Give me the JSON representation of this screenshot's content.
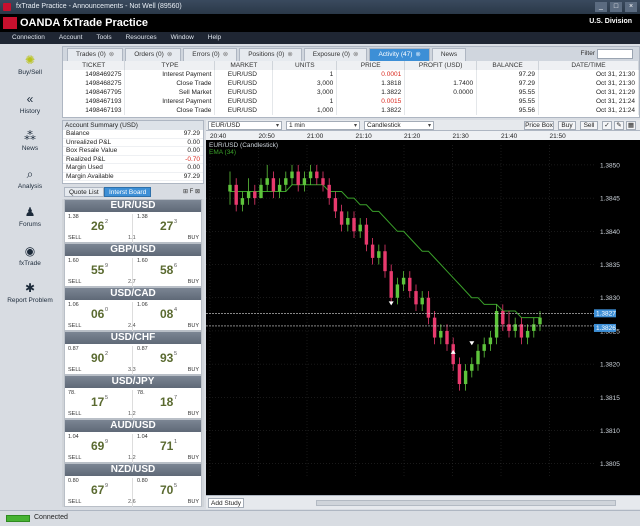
{
  "window": {
    "title": "fxTrade Practice - Announcements - Not Well (89560)",
    "controls": [
      "_",
      "□",
      "×"
    ]
  },
  "brand": {
    "logo": "OANDA fxTrade Practice",
    "division": "U.S. Division"
  },
  "menu": [
    "Connection",
    "Account",
    "Tools",
    "Resources",
    "Window",
    "Help"
  ],
  "nav": [
    {
      "label": "Buy/Sell",
      "icon": "coin-icon"
    },
    {
      "label": "History",
      "icon": "back-arrows-icon"
    },
    {
      "label": "News",
      "icon": "news-icon"
    },
    {
      "label": "Analysis",
      "icon": "magnifier-icon"
    },
    {
      "label": "Forums",
      "icon": "people-icon"
    },
    {
      "label": "fxTrade",
      "icon": "fxtrade-logo-icon"
    },
    {
      "label": "Report Problem",
      "icon": "bug-icon"
    }
  ],
  "top_tabs": [
    {
      "label": "Trades (0)",
      "active": false
    },
    {
      "label": "Orders (0)",
      "active": false
    },
    {
      "label": "Errors (0)",
      "active": false
    },
    {
      "label": "Positions (0)",
      "active": false
    },
    {
      "label": "Exposure (0)",
      "active": false
    },
    {
      "label": "Activity (47)",
      "active": true
    },
    {
      "label": "News",
      "active": false
    }
  ],
  "filter_label": "Filter",
  "activity": {
    "columns": [
      "TICKET",
      "TYPE",
      "MARKET",
      "UNITS",
      "PRICE",
      "PROFIT (USD)",
      "BALANCE",
      "DATE/TIME"
    ],
    "rows": [
      {
        "ticket": "1498469275",
        "type": "Interest Payment",
        "market": "EUR/USD",
        "units": "1",
        "price": "0.0001",
        "price_neg": true,
        "profit": "",
        "balance": "97.29",
        "datetime": "Oct 31, 21:30"
      },
      {
        "ticket": "1498468275",
        "type": "Close Trade",
        "market": "EUR/USD",
        "units": "3,000",
        "price": "1.3818",
        "price_neg": false,
        "profit": "1.7400",
        "balance": "97.29",
        "datetime": "Oct 31, 21:30"
      },
      {
        "ticket": "1498467795",
        "type": "Sell Market",
        "market": "EUR/USD",
        "units": "3,000",
        "price": "1.3822",
        "price_neg": false,
        "profit": "0.0000",
        "balance": "95.55",
        "datetime": "Oct 31, 21:29"
      },
      {
        "ticket": "1498467193",
        "type": "Interest Payment",
        "market": "EUR/USD",
        "units": "1",
        "price": "0.0015",
        "price_neg": true,
        "profit": "",
        "balance": "95.55",
        "datetime": "Oct 31, 21:24"
      },
      {
        "ticket": "1498467193",
        "type": "Close Trade",
        "market": "EUR/USD",
        "units": "1,000",
        "price": "1.3822",
        "price_neg": false,
        "profit": "",
        "balance": "95.56",
        "datetime": "Oct 31, 21:24"
      }
    ]
  },
  "account": {
    "title": "Account Summary (USD)",
    "rows": [
      {
        "label": "Balance",
        "value": "97.29",
        "neg": false
      },
      {
        "label": "Unrealized P&L",
        "value": "0.00",
        "neg": false
      },
      {
        "label": "Box Resale Value",
        "value": "0.00",
        "neg": false
      },
      {
        "label": "Realized P&L",
        "value": "-0.70",
        "neg": true
      },
      {
        "label": "Margin Used",
        "value": "0.00",
        "neg": false
      },
      {
        "label": "Margin Available",
        "value": "97.29",
        "neg": false
      }
    ]
  },
  "quote_tabs": [
    "Quote List",
    "Interst Board"
  ],
  "quote_tools": "⊞ F ⊠",
  "quotes": [
    {
      "pair": "EUR/USD",
      "sell_small": "1.38",
      "sell_big": "26",
      "sell_sup": "2",
      "buy_small": "1.38",
      "buy_big": "27",
      "buy_sup": "3",
      "spread": "1.1",
      "sell": "SELL",
      "buy": "BUY"
    },
    {
      "pair": "GBP/USD",
      "sell_small": "1.60",
      "sell_big": "55",
      "sell_sup": "9",
      "buy_small": "1.60",
      "buy_big": "58",
      "buy_sup": "6",
      "spread": "2.7",
      "sell": "SELL",
      "buy": "BUY"
    },
    {
      "pair": "USD/CAD",
      "sell_small": "1.06",
      "sell_big": "06",
      "sell_sup": "0",
      "buy_small": "1.06",
      "buy_big": "08",
      "buy_sup": "4",
      "spread": "2.4",
      "sell": "SELL",
      "buy": "BUY"
    },
    {
      "pair": "USD/CHF",
      "sell_small": "0.87",
      "sell_big": "90",
      "sell_sup": "2",
      "buy_small": "0.87",
      "buy_big": "93",
      "buy_sup": "5",
      "spread": "3.3",
      "sell": "SELL",
      "buy": "BUY"
    },
    {
      "pair": "USD/JPY",
      "sell_small": "78.",
      "sell_big": "17",
      "sell_sup": "5",
      "buy_small": "78.",
      "buy_big": "18",
      "buy_sup": "7",
      "spread": "1.2",
      "sell": "SELL",
      "buy": "BUY"
    },
    {
      "pair": "AUD/USD",
      "sell_small": "1.04",
      "sell_big": "69",
      "sell_sup": "9",
      "buy_small": "1.04",
      "buy_big": "71",
      "buy_sup": "1",
      "spread": "1.2",
      "sell": "SELL",
      "buy": "BUY"
    },
    {
      "pair": "NZD/USD",
      "sell_small": "0.80",
      "sell_big": "67",
      "sell_sup": "9",
      "buy_small": "0.80",
      "buy_big": "70",
      "buy_sup": "5",
      "spread": "2.6",
      "sell": "SELL",
      "buy": "BUY"
    }
  ],
  "chart_toolbar": {
    "instrument": "EUR/USD",
    "granularity": "1 min",
    "style": "Candlestick",
    "price_box": "Price Box",
    "buy": "Buy",
    "sell": "Sell"
  },
  "chart_bottom": {
    "add_study": "Add Study"
  },
  "status": {
    "text": "Connected",
    "color": "#47b233"
  },
  "chart_data": {
    "type": "candlestick",
    "title": "EUR/USD (Candlestick)",
    "series_label": "EMA (34)",
    "time_labels": [
      "20:40",
      "20:50",
      "21:00",
      "21:10",
      "21:20",
      "21:30",
      "21:40",
      "21:50"
    ],
    "price_ticks": [
      "1.3850",
      "1.3845",
      "1.3840",
      "1.3835",
      "1.3830",
      "1.3825",
      "1.3820",
      "1.3815",
      "1.3810",
      "1.3805"
    ],
    "ylim": [
      1.3803,
      1.3853
    ],
    "bid": "1.3827",
    "ask": "1.3826",
    "bid_value": 1.38272,
    "ask_value": 1.38262,
    "colors": {
      "up": "#5ec43c",
      "down": "#e83a6e",
      "ema": "#3aa02a",
      "grid": "#333333",
      "bg": "#000000"
    },
    "candles": [
      [
        1.3846,
        1.3849,
        1.3844,
        1.3847
      ],
      [
        1.3847,
        1.3848,
        1.3843,
        1.3844
      ],
      [
        1.3844,
        1.3846,
        1.3843,
        1.3845
      ],
      [
        1.3845,
        1.3848,
        1.3844,
        1.3846
      ],
      [
        1.3846,
        1.3847,
        1.3844,
        1.3845
      ],
      [
        1.3845,
        1.3848,
        1.3845,
        1.3847
      ],
      [
        1.3847,
        1.385,
        1.3846,
        1.3848
      ],
      [
        1.3848,
        1.3849,
        1.3845,
        1.3846
      ],
      [
        1.3846,
        1.3848,
        1.3845,
        1.3847
      ],
      [
        1.3847,
        1.3849,
        1.3846,
        1.3848
      ],
      [
        1.3848,
        1.385,
        1.3847,
        1.3849
      ],
      [
        1.3849,
        1.385,
        1.3846,
        1.3847
      ],
      [
        1.3847,
        1.3849,
        1.3846,
        1.3848
      ],
      [
        1.3848,
        1.385,
        1.3847,
        1.3849
      ],
      [
        1.3849,
        1.385,
        1.3847,
        1.3848
      ],
      [
        1.3848,
        1.3849,
        1.3846,
        1.3847
      ],
      [
        1.3847,
        1.3848,
        1.3844,
        1.3845
      ],
      [
        1.3845,
        1.3846,
        1.3842,
        1.3843
      ],
      [
        1.3843,
        1.3844,
        1.384,
        1.3841
      ],
      [
        1.3841,
        1.3843,
        1.384,
        1.3842
      ],
      [
        1.3842,
        1.3843,
        1.3839,
        1.384
      ],
      [
        1.384,
        1.3842,
        1.3839,
        1.3841
      ],
      [
        1.3841,
        1.3842,
        1.3837,
        1.3838
      ],
      [
        1.3838,
        1.3839,
        1.3835,
        1.3836
      ],
      [
        1.3836,
        1.3838,
        1.3835,
        1.3837
      ],
      [
        1.3837,
        1.3838,
        1.3833,
        1.3834
      ],
      [
        1.3834,
        1.3835,
        1.3829,
        1.383
      ],
      [
        1.383,
        1.3833,
        1.3829,
        1.3832
      ],
      [
        1.3832,
        1.3834,
        1.3831,
        1.3833
      ],
      [
        1.3833,
        1.3834,
        1.383,
        1.3831
      ],
      [
        1.3831,
        1.3832,
        1.3828,
        1.3829
      ],
      [
        1.3829,
        1.3831,
        1.3828,
        1.383
      ],
      [
        1.383,
        1.3831,
        1.3826,
        1.3827
      ],
      [
        1.3827,
        1.3828,
        1.3823,
        1.3824
      ],
      [
        1.3824,
        1.3826,
        1.3823,
        1.3825
      ],
      [
        1.3825,
        1.3826,
        1.3822,
        1.3823
      ],
      [
        1.3823,
        1.3824,
        1.3819,
        1.382
      ],
      [
        1.382,
        1.3821,
        1.3816,
        1.3817
      ],
      [
        1.3817,
        1.382,
        1.3816,
        1.3819
      ],
      [
        1.3819,
        1.3821,
        1.3818,
        1.382
      ],
      [
        1.382,
        1.3823,
        1.3819,
        1.3822
      ],
      [
        1.3822,
        1.3824,
        1.3821,
        1.3823
      ],
      [
        1.3823,
        1.3825,
        1.3822,
        1.3824
      ],
      [
        1.3824,
        1.3829,
        1.3823,
        1.3828
      ],
      [
        1.3828,
        1.3829,
        1.3825,
        1.3826
      ],
      [
        1.3826,
        1.3828,
        1.3824,
        1.3825
      ],
      [
        1.3825,
        1.3827,
        1.3824,
        1.3826
      ],
      [
        1.3826,
        1.3827,
        1.3823,
        1.3824
      ],
      [
        1.3824,
        1.3826,
        1.3823,
        1.3825
      ],
      [
        1.3825,
        1.3827,
        1.3824,
        1.3826
      ],
      [
        1.3826,
        1.3828,
        1.3825,
        1.3827
      ]
    ],
    "ema": [
      1.3846,
      1.3846,
      1.3846,
      1.3846,
      1.3846,
      1.3846,
      1.3846,
      1.3846,
      1.3846,
      1.3846,
      1.3847,
      1.3847,
      1.3847,
      1.3847,
      1.3847,
      1.3847,
      1.3846,
      1.3846,
      1.3846,
      1.3845,
      1.3845,
      1.3844,
      1.3844,
      1.3843,
      1.3843,
      1.3842,
      1.3841,
      1.384,
      1.384,
      1.3839,
      1.3838,
      1.3837,
      1.3837,
      1.3836,
      1.3835,
      1.3834,
      1.3833,
      1.3832,
      1.3831,
      1.383,
      1.383,
      1.3829,
      1.3829,
      1.3829,
      1.3828,
      1.3828,
      1.3828,
      1.3827,
      1.3827,
      1.3827,
      1.3827
    ],
    "markers": [
      {
        "index": 26,
        "price": 1.3829,
        "kind": "sell"
      },
      {
        "index": 36,
        "price": 1.3822,
        "kind": "buy"
      },
      {
        "index": 39,
        "price": 1.3823,
        "kind": "sell"
      }
    ]
  }
}
